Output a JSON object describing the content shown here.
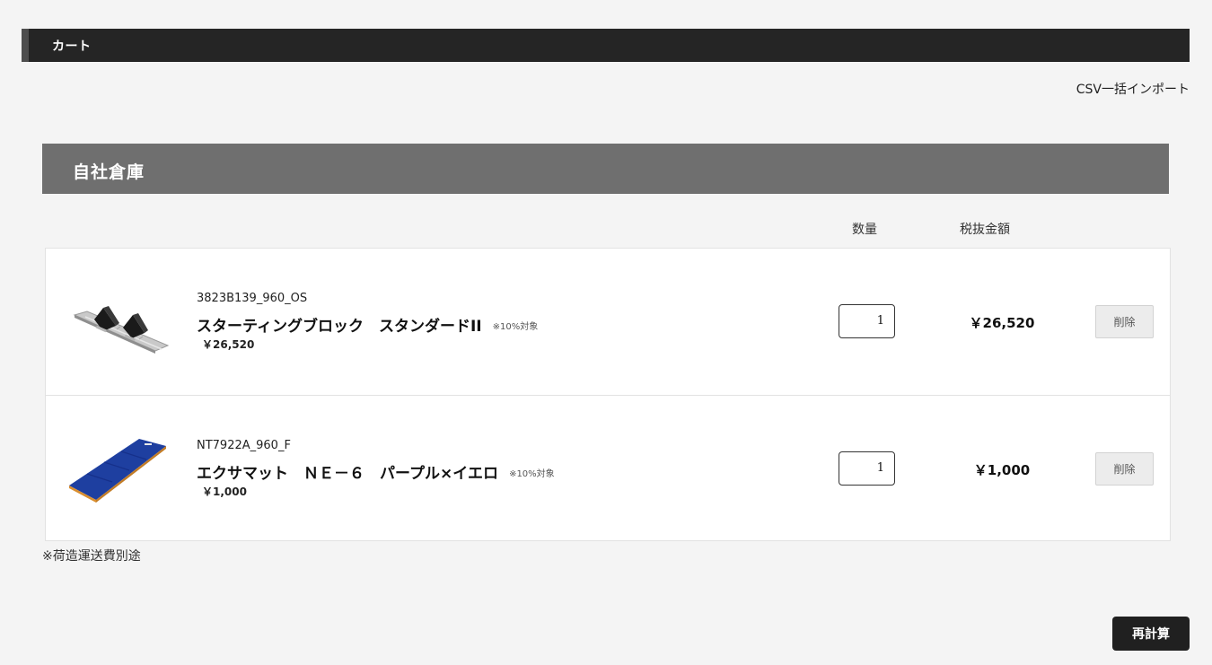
{
  "page": {
    "title": "カート",
    "csv_import_label": "CSV一括インポート"
  },
  "warehouse": {
    "title": "自社倉庫",
    "columns": {
      "quantity": "数量",
      "amount_excl_tax": "税抜金額"
    },
    "items": [
      {
        "image": "starting-block-image",
        "code": "3823B139_960_OS",
        "name": "スターティングブロック　スタンダードII",
        "tax_note": "※10%対象",
        "unit_price": "￥26,520",
        "quantity": "1",
        "line_total": "￥26,520",
        "delete_label": "削除"
      },
      {
        "image": "exercise-mat-image",
        "code": "NT7922A_960_F",
        "name": "エクサマット　ＮＥ－６　パープル×イエロ",
        "tax_note": "※10%対象",
        "unit_price": "￥1,000",
        "quantity": "1",
        "line_total": "￥1,000",
        "delete_label": "削除"
      }
    ],
    "shipping_note": "※荷造運送費別途"
  },
  "actions": {
    "recalculate_label": "再計算"
  },
  "colors": {
    "title_bar": "#252525",
    "warehouse_header": "#6f6f6f",
    "page_background": "#f4f4f4",
    "row_background": "#ffffff",
    "recalculate_button": "#202020",
    "delete_button": "#ececec",
    "mat_blue": "#1e3fa0",
    "mat_edge": "#d98e2f"
  }
}
